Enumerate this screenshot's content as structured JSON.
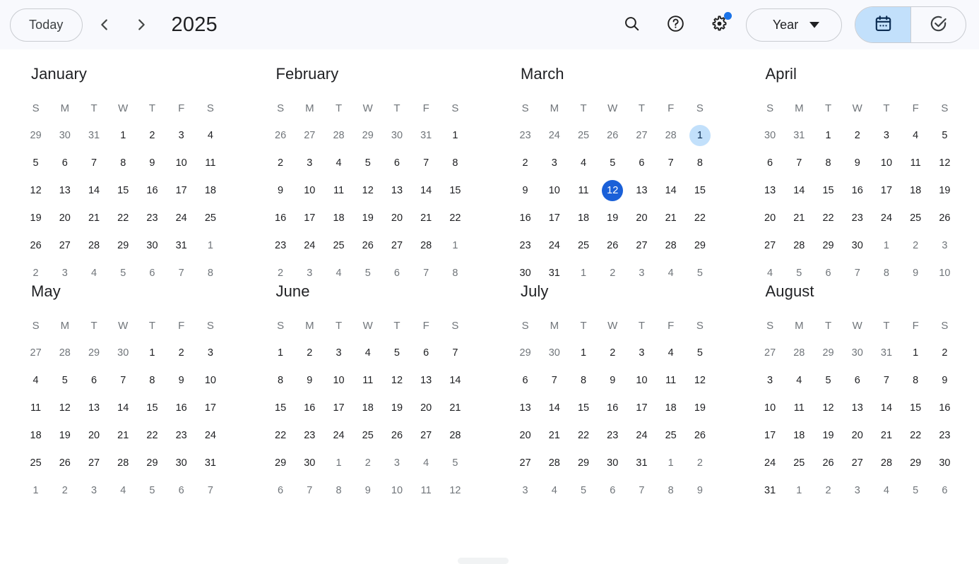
{
  "header": {
    "today_label": "Today",
    "prev_label": "Previous year",
    "next_label": "Next year",
    "period_title": "2025",
    "search_label": "Search",
    "help_label": "Support",
    "settings_label": "Settings menu",
    "view_label": "Year",
    "calendar_mode_label": "Calendar",
    "tasks_mode_label": "Tasks"
  },
  "colors": {
    "header_background": "#f8f9fd",
    "today_accent": "#1a60d8",
    "selected_accent": "#c2e0fb",
    "badge": "#1a73e8",
    "text_primary": "#202124",
    "text_muted": "#70757a"
  },
  "weekdays": [
    "S",
    "M",
    "T",
    "W",
    "T",
    "F",
    "S"
  ],
  "months": [
    {
      "name": "January",
      "weeks": [
        [
          {
            "d": "29",
            "o": true
          },
          {
            "d": "30",
            "o": true
          },
          {
            "d": "31",
            "o": true
          },
          {
            "d": "1"
          },
          {
            "d": "2"
          },
          {
            "d": "3"
          },
          {
            "d": "4"
          }
        ],
        [
          {
            "d": "5"
          },
          {
            "d": "6"
          },
          {
            "d": "7"
          },
          {
            "d": "8"
          },
          {
            "d": "9"
          },
          {
            "d": "10"
          },
          {
            "d": "11"
          }
        ],
        [
          {
            "d": "12"
          },
          {
            "d": "13"
          },
          {
            "d": "14"
          },
          {
            "d": "15"
          },
          {
            "d": "16"
          },
          {
            "d": "17"
          },
          {
            "d": "18"
          }
        ],
        [
          {
            "d": "19"
          },
          {
            "d": "20"
          },
          {
            "d": "21"
          },
          {
            "d": "22"
          },
          {
            "d": "23"
          },
          {
            "d": "24"
          },
          {
            "d": "25"
          }
        ],
        [
          {
            "d": "26"
          },
          {
            "d": "27"
          },
          {
            "d": "28"
          },
          {
            "d": "29"
          },
          {
            "d": "30"
          },
          {
            "d": "31"
          },
          {
            "d": "1",
            "o": true
          }
        ],
        [
          {
            "d": "2",
            "o": true
          },
          {
            "d": "3",
            "o": true
          },
          {
            "d": "4",
            "o": true
          },
          {
            "d": "5",
            "o": true
          },
          {
            "d": "6",
            "o": true
          },
          {
            "d": "7",
            "o": true
          },
          {
            "d": "8",
            "o": true
          }
        ]
      ]
    },
    {
      "name": "February",
      "weeks": [
        [
          {
            "d": "26",
            "o": true
          },
          {
            "d": "27",
            "o": true
          },
          {
            "d": "28",
            "o": true
          },
          {
            "d": "29",
            "o": true
          },
          {
            "d": "30",
            "o": true
          },
          {
            "d": "31",
            "o": true
          },
          {
            "d": "1"
          }
        ],
        [
          {
            "d": "2"
          },
          {
            "d": "3"
          },
          {
            "d": "4"
          },
          {
            "d": "5"
          },
          {
            "d": "6"
          },
          {
            "d": "7"
          },
          {
            "d": "8"
          }
        ],
        [
          {
            "d": "9"
          },
          {
            "d": "10"
          },
          {
            "d": "11"
          },
          {
            "d": "12"
          },
          {
            "d": "13"
          },
          {
            "d": "14"
          },
          {
            "d": "15"
          }
        ],
        [
          {
            "d": "16"
          },
          {
            "d": "17"
          },
          {
            "d": "18"
          },
          {
            "d": "19"
          },
          {
            "d": "20"
          },
          {
            "d": "21"
          },
          {
            "d": "22"
          }
        ],
        [
          {
            "d": "23"
          },
          {
            "d": "24"
          },
          {
            "d": "25"
          },
          {
            "d": "26"
          },
          {
            "d": "27"
          },
          {
            "d": "28"
          },
          {
            "d": "1",
            "o": true
          }
        ],
        [
          {
            "d": "2",
            "o": true
          },
          {
            "d": "3",
            "o": true
          },
          {
            "d": "4",
            "o": true
          },
          {
            "d": "5",
            "o": true
          },
          {
            "d": "6",
            "o": true
          },
          {
            "d": "7",
            "o": true
          },
          {
            "d": "8",
            "o": true
          }
        ]
      ]
    },
    {
      "name": "March",
      "weeks": [
        [
          {
            "d": "23",
            "o": true
          },
          {
            "d": "24",
            "o": true
          },
          {
            "d": "25",
            "o": true
          },
          {
            "d": "26",
            "o": true
          },
          {
            "d": "27",
            "o": true
          },
          {
            "d": "28",
            "o": true
          },
          {
            "d": "1",
            "selected": true
          }
        ],
        [
          {
            "d": "2"
          },
          {
            "d": "3"
          },
          {
            "d": "4"
          },
          {
            "d": "5"
          },
          {
            "d": "6"
          },
          {
            "d": "7"
          },
          {
            "d": "8"
          }
        ],
        [
          {
            "d": "9"
          },
          {
            "d": "10"
          },
          {
            "d": "11"
          },
          {
            "d": "12",
            "today": true
          },
          {
            "d": "13"
          },
          {
            "d": "14"
          },
          {
            "d": "15"
          }
        ],
        [
          {
            "d": "16"
          },
          {
            "d": "17"
          },
          {
            "d": "18"
          },
          {
            "d": "19"
          },
          {
            "d": "20"
          },
          {
            "d": "21"
          },
          {
            "d": "22"
          }
        ],
        [
          {
            "d": "23"
          },
          {
            "d": "24"
          },
          {
            "d": "25"
          },
          {
            "d": "26"
          },
          {
            "d": "27"
          },
          {
            "d": "28"
          },
          {
            "d": "29"
          }
        ],
        [
          {
            "d": "30"
          },
          {
            "d": "31"
          },
          {
            "d": "1",
            "o": true
          },
          {
            "d": "2",
            "o": true
          },
          {
            "d": "3",
            "o": true
          },
          {
            "d": "4",
            "o": true
          },
          {
            "d": "5",
            "o": true
          }
        ]
      ]
    },
    {
      "name": "April",
      "weeks": [
        [
          {
            "d": "30",
            "o": true
          },
          {
            "d": "31",
            "o": true
          },
          {
            "d": "1"
          },
          {
            "d": "2"
          },
          {
            "d": "3"
          },
          {
            "d": "4"
          },
          {
            "d": "5"
          }
        ],
        [
          {
            "d": "6"
          },
          {
            "d": "7"
          },
          {
            "d": "8"
          },
          {
            "d": "9"
          },
          {
            "d": "10"
          },
          {
            "d": "11"
          },
          {
            "d": "12"
          }
        ],
        [
          {
            "d": "13"
          },
          {
            "d": "14"
          },
          {
            "d": "15"
          },
          {
            "d": "16"
          },
          {
            "d": "17"
          },
          {
            "d": "18"
          },
          {
            "d": "19"
          }
        ],
        [
          {
            "d": "20"
          },
          {
            "d": "21"
          },
          {
            "d": "22"
          },
          {
            "d": "23"
          },
          {
            "d": "24"
          },
          {
            "d": "25"
          },
          {
            "d": "26"
          }
        ],
        [
          {
            "d": "27"
          },
          {
            "d": "28"
          },
          {
            "d": "29"
          },
          {
            "d": "30"
          },
          {
            "d": "1",
            "o": true
          },
          {
            "d": "2",
            "o": true
          },
          {
            "d": "3",
            "o": true
          }
        ],
        [
          {
            "d": "4",
            "o": true
          },
          {
            "d": "5",
            "o": true
          },
          {
            "d": "6",
            "o": true
          },
          {
            "d": "7",
            "o": true
          },
          {
            "d": "8",
            "o": true
          },
          {
            "d": "9",
            "o": true
          },
          {
            "d": "10",
            "o": true
          }
        ]
      ]
    },
    {
      "name": "May",
      "weeks": [
        [
          {
            "d": "27",
            "o": true
          },
          {
            "d": "28",
            "o": true
          },
          {
            "d": "29",
            "o": true
          },
          {
            "d": "30",
            "o": true
          },
          {
            "d": "1"
          },
          {
            "d": "2"
          },
          {
            "d": "3"
          }
        ],
        [
          {
            "d": "4"
          },
          {
            "d": "5"
          },
          {
            "d": "6"
          },
          {
            "d": "7"
          },
          {
            "d": "8"
          },
          {
            "d": "9"
          },
          {
            "d": "10"
          }
        ],
        [
          {
            "d": "11"
          },
          {
            "d": "12"
          },
          {
            "d": "13"
          },
          {
            "d": "14"
          },
          {
            "d": "15"
          },
          {
            "d": "16"
          },
          {
            "d": "17"
          }
        ],
        [
          {
            "d": "18"
          },
          {
            "d": "19"
          },
          {
            "d": "20"
          },
          {
            "d": "21"
          },
          {
            "d": "22"
          },
          {
            "d": "23"
          },
          {
            "d": "24"
          }
        ],
        [
          {
            "d": "25"
          },
          {
            "d": "26"
          },
          {
            "d": "27"
          },
          {
            "d": "28"
          },
          {
            "d": "29"
          },
          {
            "d": "30"
          },
          {
            "d": "31"
          }
        ],
        [
          {
            "d": "1",
            "o": true
          },
          {
            "d": "2",
            "o": true
          },
          {
            "d": "3",
            "o": true
          },
          {
            "d": "4",
            "o": true
          },
          {
            "d": "5",
            "o": true
          },
          {
            "d": "6",
            "o": true
          },
          {
            "d": "7",
            "o": true
          }
        ]
      ]
    },
    {
      "name": "June",
      "weeks": [
        [
          {
            "d": "1"
          },
          {
            "d": "2"
          },
          {
            "d": "3"
          },
          {
            "d": "4"
          },
          {
            "d": "5"
          },
          {
            "d": "6"
          },
          {
            "d": "7"
          }
        ],
        [
          {
            "d": "8"
          },
          {
            "d": "9"
          },
          {
            "d": "10"
          },
          {
            "d": "11"
          },
          {
            "d": "12"
          },
          {
            "d": "13"
          },
          {
            "d": "14"
          }
        ],
        [
          {
            "d": "15"
          },
          {
            "d": "16"
          },
          {
            "d": "17"
          },
          {
            "d": "18"
          },
          {
            "d": "19"
          },
          {
            "d": "20"
          },
          {
            "d": "21"
          }
        ],
        [
          {
            "d": "22"
          },
          {
            "d": "23"
          },
          {
            "d": "24"
          },
          {
            "d": "25"
          },
          {
            "d": "26"
          },
          {
            "d": "27"
          },
          {
            "d": "28"
          }
        ],
        [
          {
            "d": "29"
          },
          {
            "d": "30"
          },
          {
            "d": "1",
            "o": true
          },
          {
            "d": "2",
            "o": true
          },
          {
            "d": "3",
            "o": true
          },
          {
            "d": "4",
            "o": true
          },
          {
            "d": "5",
            "o": true
          }
        ],
        [
          {
            "d": "6",
            "o": true
          },
          {
            "d": "7",
            "o": true
          },
          {
            "d": "8",
            "o": true
          },
          {
            "d": "9",
            "o": true
          },
          {
            "d": "10",
            "o": true
          },
          {
            "d": "11",
            "o": true
          },
          {
            "d": "12",
            "o": true
          }
        ]
      ]
    },
    {
      "name": "July",
      "weeks": [
        [
          {
            "d": "29",
            "o": true
          },
          {
            "d": "30",
            "o": true
          },
          {
            "d": "1"
          },
          {
            "d": "2"
          },
          {
            "d": "3"
          },
          {
            "d": "4"
          },
          {
            "d": "5"
          }
        ],
        [
          {
            "d": "6"
          },
          {
            "d": "7"
          },
          {
            "d": "8"
          },
          {
            "d": "9"
          },
          {
            "d": "10"
          },
          {
            "d": "11"
          },
          {
            "d": "12"
          }
        ],
        [
          {
            "d": "13"
          },
          {
            "d": "14"
          },
          {
            "d": "15"
          },
          {
            "d": "16"
          },
          {
            "d": "17"
          },
          {
            "d": "18"
          },
          {
            "d": "19"
          }
        ],
        [
          {
            "d": "20"
          },
          {
            "d": "21"
          },
          {
            "d": "22"
          },
          {
            "d": "23"
          },
          {
            "d": "24"
          },
          {
            "d": "25"
          },
          {
            "d": "26"
          }
        ],
        [
          {
            "d": "27"
          },
          {
            "d": "28"
          },
          {
            "d": "29"
          },
          {
            "d": "30"
          },
          {
            "d": "31"
          },
          {
            "d": "1",
            "o": true
          },
          {
            "d": "2",
            "o": true
          }
        ],
        [
          {
            "d": "3",
            "o": true
          },
          {
            "d": "4",
            "o": true
          },
          {
            "d": "5",
            "o": true
          },
          {
            "d": "6",
            "o": true
          },
          {
            "d": "7",
            "o": true
          },
          {
            "d": "8",
            "o": true
          },
          {
            "d": "9",
            "o": true
          }
        ]
      ]
    },
    {
      "name": "August",
      "weeks": [
        [
          {
            "d": "27",
            "o": true
          },
          {
            "d": "28",
            "o": true
          },
          {
            "d": "29",
            "o": true
          },
          {
            "d": "30",
            "o": true
          },
          {
            "d": "31",
            "o": true
          },
          {
            "d": "1"
          },
          {
            "d": "2"
          }
        ],
        [
          {
            "d": "3"
          },
          {
            "d": "4"
          },
          {
            "d": "5"
          },
          {
            "d": "6"
          },
          {
            "d": "7"
          },
          {
            "d": "8"
          },
          {
            "d": "9"
          }
        ],
        [
          {
            "d": "10"
          },
          {
            "d": "11"
          },
          {
            "d": "12"
          },
          {
            "d": "13"
          },
          {
            "d": "14"
          },
          {
            "d": "15"
          },
          {
            "d": "16"
          }
        ],
        [
          {
            "d": "17"
          },
          {
            "d": "18"
          },
          {
            "d": "19"
          },
          {
            "d": "20"
          },
          {
            "d": "21"
          },
          {
            "d": "22"
          },
          {
            "d": "23"
          }
        ],
        [
          {
            "d": "24"
          },
          {
            "d": "25"
          },
          {
            "d": "26"
          },
          {
            "d": "27"
          },
          {
            "d": "28"
          },
          {
            "d": "29"
          },
          {
            "d": "30"
          }
        ],
        [
          {
            "d": "31"
          },
          {
            "d": "1",
            "o": true
          },
          {
            "d": "2",
            "o": true
          },
          {
            "d": "3",
            "o": true
          },
          {
            "d": "4",
            "o": true
          },
          {
            "d": "5",
            "o": true
          },
          {
            "d": "6",
            "o": true
          }
        ]
      ]
    }
  ]
}
